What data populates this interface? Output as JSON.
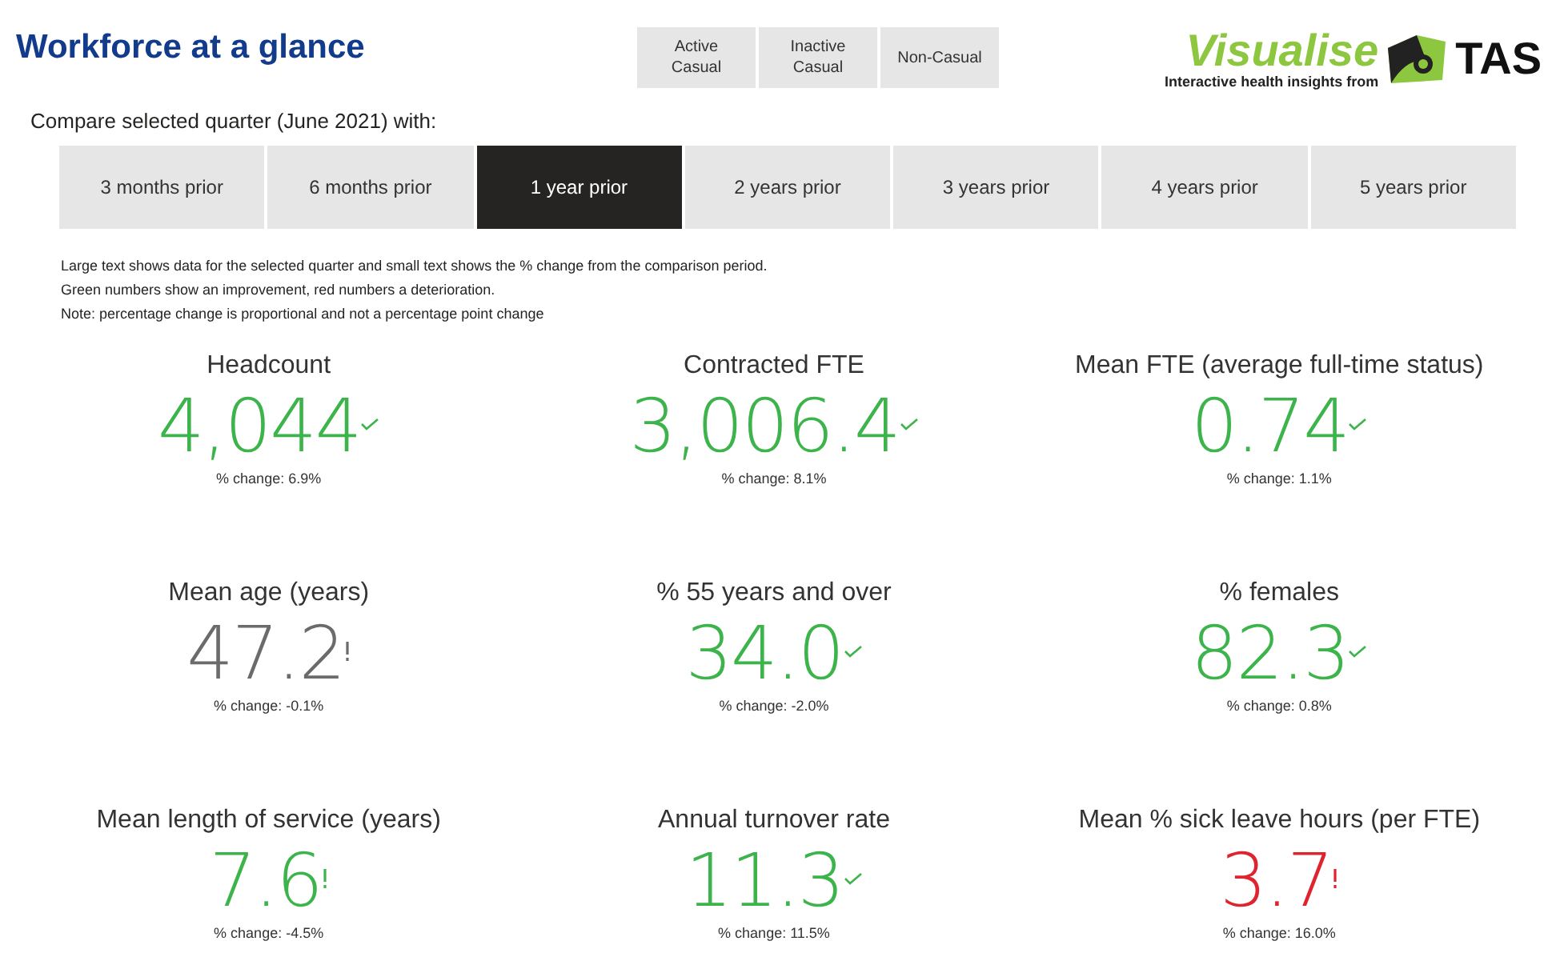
{
  "header": {
    "title": "Workforce at a glance"
  },
  "filters": [
    {
      "label": "Active\nCasual",
      "selected": false
    },
    {
      "label": "Inactive\nCasual",
      "selected": false
    },
    {
      "label": "Non-Casual",
      "selected": false
    }
  ],
  "logo": {
    "brand": "Visualise",
    "tagline": "Interactive health insights from",
    "company": "TAS"
  },
  "compare": {
    "label": "Compare selected quarter (June 2021) with:",
    "tabs": [
      {
        "label": "3 months prior",
        "selected": false
      },
      {
        "label": "6 months prior",
        "selected": false
      },
      {
        "label": "1 year prior",
        "selected": true
      },
      {
        "label": "2 years prior",
        "selected": false
      },
      {
        "label": "3 years prior",
        "selected": false
      },
      {
        "label": "4 years prior",
        "selected": false
      },
      {
        "label": "5 years prior",
        "selected": false
      }
    ]
  },
  "notes": [
    "Large text shows data for the selected quarter and small text shows the % change from the comparison period.",
    "Green numbers show an improvement, red numbers a deterioration.",
    "Note: percentage change is proportional and not a percentage point change"
  ],
  "cards": [
    {
      "title": "Headcount",
      "value": "4,044",
      "change": "% change: 6.9%",
      "color": "#3cb44b",
      "alert": false
    },
    {
      "title": "Contracted FTE",
      "value": "3,006.4",
      "change": "% change: 8.1%",
      "color": "#3cb44b",
      "alert": false
    },
    {
      "title": "Mean FTE (average full-time status)",
      "value": "0.74",
      "change": "% change: 1.1%",
      "color": "#3cb44b",
      "alert": false
    },
    {
      "title": "Mean age (years)",
      "value": "47.2",
      "change": "% change: -0.1%",
      "color": "#6b6b6b",
      "alert": true
    },
    {
      "title": "% 55 years and over",
      "value": "34.0",
      "change": "% change: -2.0%",
      "color": "#3cb44b",
      "alert": false
    },
    {
      "title": "% females",
      "value": "82.3",
      "change": "% change: 0.8%",
      "color": "#3cb44b",
      "alert": false
    },
    {
      "title": "Mean length of service (years)",
      "value": "7.6",
      "change": "% change: -4.5%",
      "color": "#3cb44b",
      "alert": true
    },
    {
      "title": "Annual turnover rate",
      "value": "11.3",
      "change": "% change: 11.5%",
      "color": "#3cb44b",
      "alert": false
    },
    {
      "title": "Mean % sick leave hours (per FTE)",
      "value": "3.7",
      "change": "% change: 16.0%",
      "color": "#e0242f",
      "alert": true
    }
  ]
}
